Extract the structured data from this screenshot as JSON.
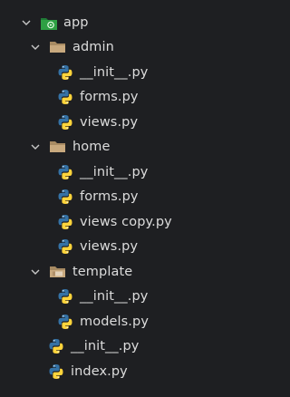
{
  "tree": {
    "root": {
      "label": "app",
      "icon": "package-folder-icon"
    },
    "admin": {
      "label": "admin",
      "icon": "folder-icon",
      "files": [
        "__init__.py",
        "forms.py",
        "views.py"
      ]
    },
    "home": {
      "label": "home",
      "icon": "folder-icon",
      "files": [
        "__init__.py",
        "forms.py",
        "views copy.py",
        "views.py"
      ]
    },
    "template": {
      "label": "template",
      "icon": "folder-icon",
      "files": [
        "__init__.py",
        "models.py"
      ]
    },
    "root_files": [
      "__init__.py",
      "index.py"
    ]
  },
  "colors": {
    "background": "#1e1f22",
    "text": "#dcdcdc",
    "python_blue": "#3572a5",
    "python_yellow": "#ffd43b",
    "folder_tan": "#c8a97e",
    "package_green": "#2ea043"
  }
}
